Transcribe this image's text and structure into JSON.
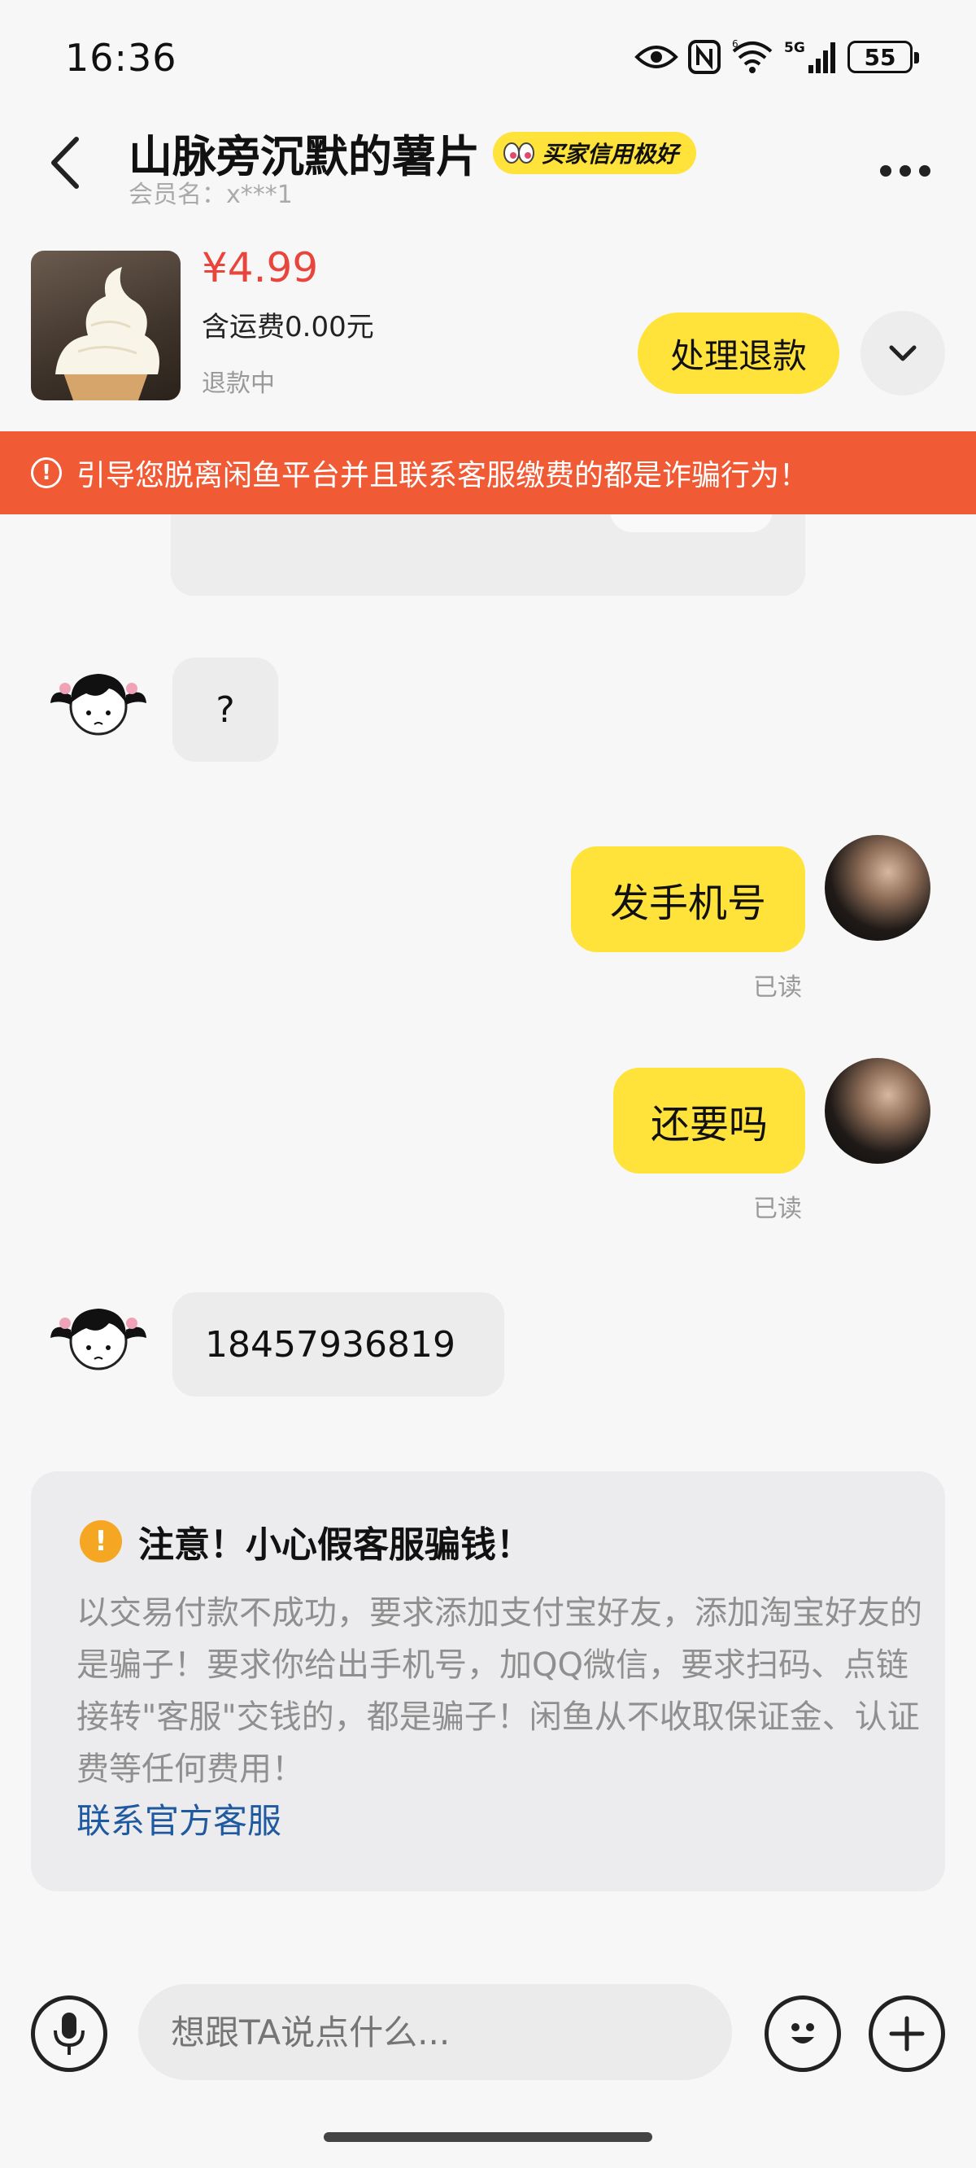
{
  "status_bar": {
    "time": "16:36",
    "battery": "55",
    "icons": [
      "eye-icon",
      "nfc-icon",
      "wifi-icon",
      "signal-5g-icon",
      "battery-icon"
    ]
  },
  "header": {
    "title": "山脉旁沉默的薯片",
    "credit_badge": "买家信用极好",
    "member_label": "会员名：x***1"
  },
  "product": {
    "price": "¥4.99",
    "shipping": "含运费0.00元",
    "status": "退款中",
    "action_label": "处理退款"
  },
  "banner": {
    "icon_text": "!",
    "text": "引导您脱离闲鱼平台并且联系客服缴费的都是诈骗行为！",
    "color": "#f05a35"
  },
  "messages": [
    {
      "side": "left",
      "text": "?"
    },
    {
      "side": "right",
      "text": "发手机号",
      "status": "已读"
    },
    {
      "side": "right",
      "text": "还要吗",
      "status": "已读"
    },
    {
      "side": "left",
      "text": "18457936819"
    }
  ],
  "notice": {
    "icon_text": "!",
    "title": "注意！小心假客服骗钱！",
    "body": "以交易付款不成功，要求添加支付宝好友，添加淘宝好友的是骗子！要求你给出手机号，加QQ微信，要求扫码、点链接转\"客服\"交钱的，都是骗子！闲鱼从不收取保证金、认证费等任何费用！",
    "link": "联系官方客服"
  },
  "input": {
    "placeholder": "想跟TA说点什么..."
  },
  "colors": {
    "accent_yellow": "#ffe33b",
    "price_red": "#e8453c",
    "link_blue": "#1f5aa0"
  }
}
